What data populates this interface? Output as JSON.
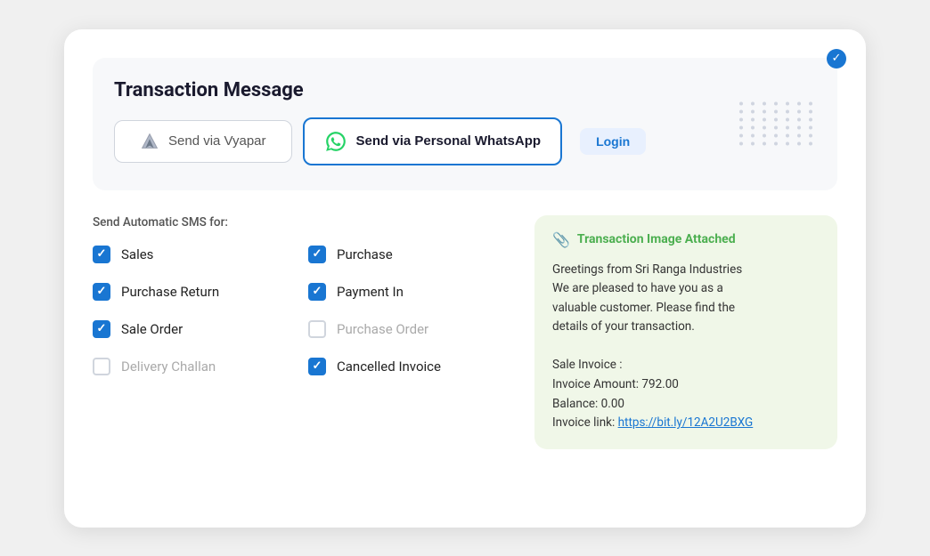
{
  "card": {
    "title": "Transaction Message",
    "send_vyapar_label": "Send via Vyapar",
    "send_whatsapp_label": "Send via Personal WhatsApp",
    "login_label": "Login"
  },
  "sms": {
    "label": "Send Automatic SMS for:",
    "items": [
      {
        "id": "sales",
        "label": "Sales",
        "checked": true,
        "disabled": false
      },
      {
        "id": "purchase",
        "label": "Purchase",
        "checked": true,
        "disabled": false
      },
      {
        "id": "purchase-return",
        "label": "Purchase Return",
        "checked": true,
        "disabled": false
      },
      {
        "id": "payment-in",
        "label": "Payment In",
        "checked": true,
        "disabled": false
      },
      {
        "id": "sale-order",
        "label": "Sale Order",
        "checked": true,
        "disabled": false
      },
      {
        "id": "purchase-order",
        "label": "Purchase Order",
        "checked": false,
        "disabled": true
      },
      {
        "id": "delivery-challan",
        "label": "Delivery Challan",
        "checked": false,
        "disabled": true
      },
      {
        "id": "cancelled-invoice",
        "label": "Cancelled Invoice",
        "checked": true,
        "disabled": false
      }
    ]
  },
  "message_card": {
    "header": "Transaction Image Attached",
    "body_line1": "Greetings from Sri Ranga Industries",
    "body_line2": "We are pleased to have you as a",
    "body_line3": "valuable customer. Please find the",
    "body_line4": "details of your transaction.",
    "body_line5": "",
    "sale_invoice_label": "Sale Invoice :",
    "invoice_amount_label": "Invoice Amount: 792.00",
    "balance_label": "Balance: 0.00",
    "invoice_link_label": "Invoice link: ",
    "invoice_link_url": "https://bit.ly/12A2U2BXG",
    "invoice_link_text": "https://bit.ly/12A2U2BXG"
  }
}
